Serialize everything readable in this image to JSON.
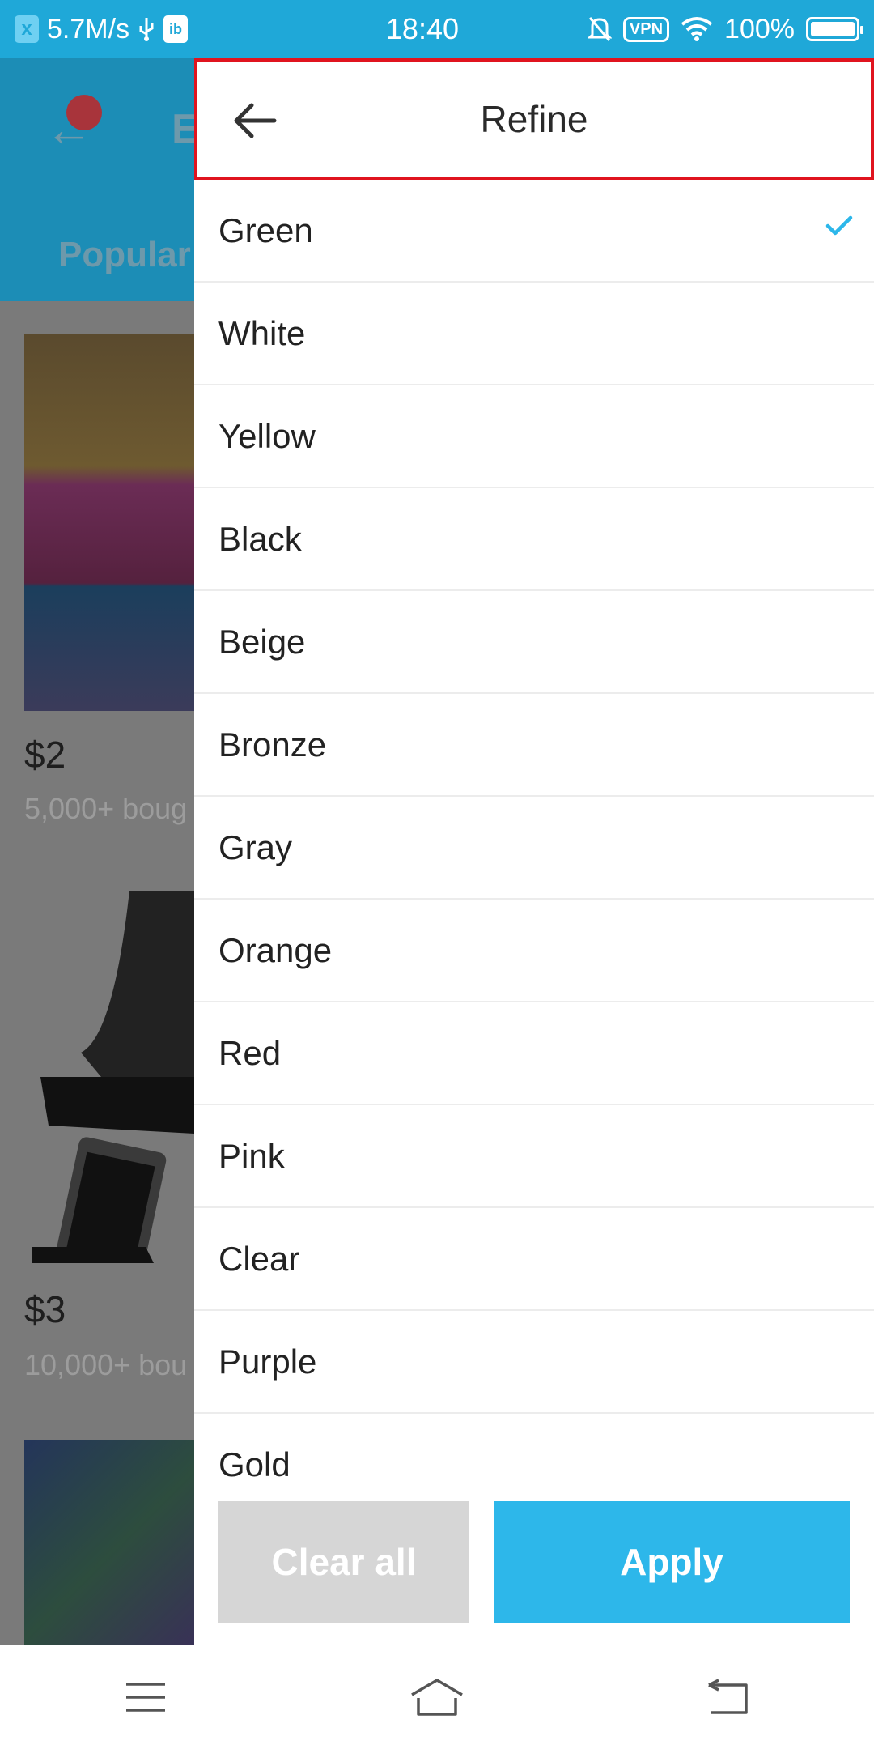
{
  "status_bar": {
    "speed": "5.7M/s",
    "time": "18:40",
    "vpn": "VPN",
    "battery": "100%"
  },
  "background": {
    "tab": "Popular",
    "title_initial": "E",
    "products": [
      {
        "price": "$2",
        "sold": "5,000+ boug"
      },
      {
        "price": "$3",
        "sold": "10,000+ bou"
      }
    ]
  },
  "refine": {
    "title": "Refine",
    "colors": [
      "Green",
      "White",
      "Yellow",
      "Black",
      "Beige",
      "Bronze",
      "Gray",
      "Orange",
      "Red",
      "Pink",
      "Clear",
      "Purple",
      "Gold"
    ],
    "selected": "Green",
    "clear_label": "Clear all",
    "apply_label": "Apply"
  },
  "colors": {
    "accent": "#2db7ea",
    "status_bar": "#1fa8d8",
    "highlight_border": "#e0141f",
    "disabled_button": "#d6d6d6"
  },
  "icons": {
    "back": "arrow-left-icon",
    "check": "check-icon",
    "menu": "menu-icon",
    "home": "home-icon",
    "return": "return-icon"
  }
}
